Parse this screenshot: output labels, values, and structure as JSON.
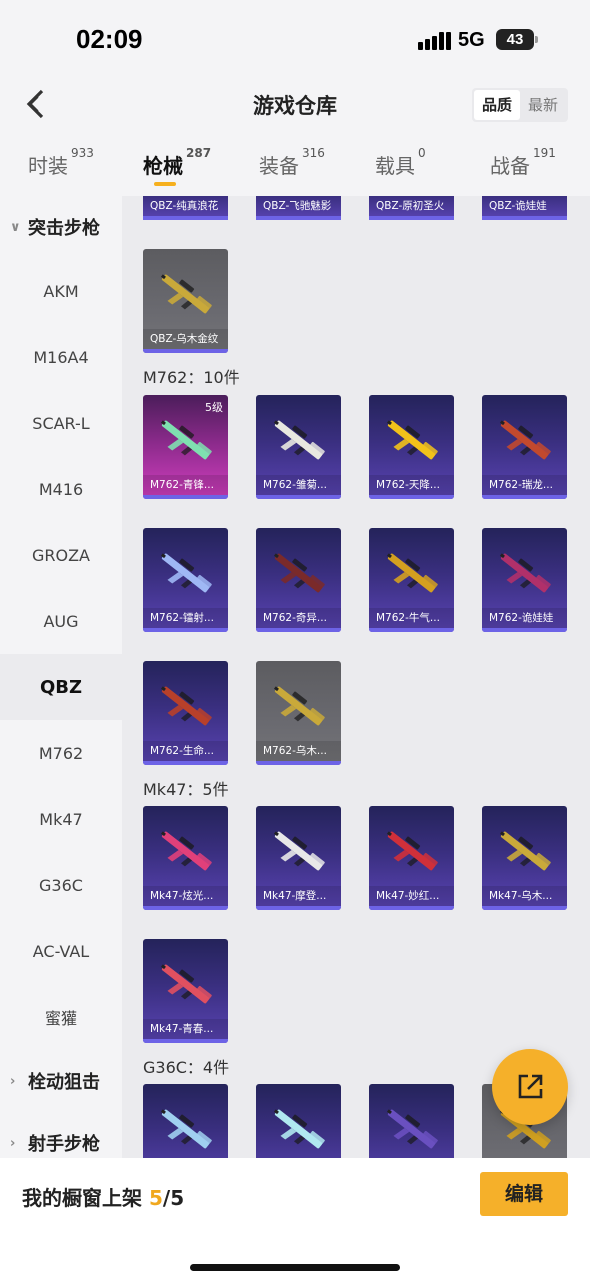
{
  "status_bar": {
    "time": "02:09",
    "network": "5G",
    "battery": "43"
  },
  "header": {
    "title": "游戏仓库",
    "sort_options": [
      "品质",
      "最新"
    ],
    "sort_active": 0
  },
  "tabs": [
    {
      "label": "时装",
      "count": "933"
    },
    {
      "label": "枪械",
      "count": "287"
    },
    {
      "label": "装备",
      "count": "316"
    },
    {
      "label": "载具",
      "count": "0"
    },
    {
      "label": "战备",
      "count": "191"
    }
  ],
  "active_tab": 1,
  "sidebar": {
    "group_assault": "突击步枪",
    "items": [
      "AKM",
      "M16A4",
      "SCAR-L",
      "M416",
      "GROZA",
      "AUG",
      "QBZ",
      "M762",
      "Mk47",
      "G36C",
      "AC-VAL",
      "蜜獾"
    ],
    "active_item": "QBZ",
    "group_bolt": "栓动狙击",
    "group_dmr": "射手步枪"
  },
  "content": {
    "top_partial_labels": [
      "QBZ-纯真浪花",
      "QBZ-飞驰魅影",
      "QBZ-原初圣火",
      "QBZ-诡娃娃"
    ],
    "qbz_last": {
      "label": "QBZ-乌木金纹",
      "style": "gray",
      "gun_color": "#c9a93a"
    },
    "m762_title": "M762：10件",
    "m762": [
      {
        "label": "M762-青锋...",
        "style": "pink",
        "level": "5级",
        "gun_color": "#7fe0b0"
      },
      {
        "label": "M762-雏菊...",
        "style": "purple",
        "gun_color": "#e8e8e0"
      },
      {
        "label": "M762-天降...",
        "style": "purple",
        "gun_color": "#f2c21a"
      },
      {
        "label": "M762-瑞龙...",
        "style": "purple",
        "gun_color": "#c2492e"
      },
      {
        "label": "M762-镭射...",
        "style": "purple",
        "gun_color": "#9fb8f5"
      },
      {
        "label": "M762-奇异...",
        "style": "purple",
        "gun_color": "#7a2a2a"
      },
      {
        "label": "M762-牛气...",
        "style": "purple",
        "gun_color": "#d4a020"
      },
      {
        "label": "M762-诡娃娃",
        "style": "purple",
        "gun_color": "#b0306a"
      },
      {
        "label": "M762-生命...",
        "style": "purple",
        "gun_color": "#b8402a"
      },
      {
        "label": "M762-乌木...",
        "style": "gray",
        "gun_color": "#c9a93a"
      }
    ],
    "mk47_title": "Mk47：5件",
    "mk47": [
      {
        "label": "Mk47-炫光...",
        "style": "purple",
        "gun_color": "#e0407a"
      },
      {
        "label": "Mk47-摩登...",
        "style": "purple",
        "gun_color": "#e8e8e8"
      },
      {
        "label": "Mk47-妙红...",
        "style": "purple",
        "gun_color": "#d0303a"
      },
      {
        "label": "Mk47-乌木...",
        "style": "purple",
        "gun_color": "#c9a93a"
      },
      {
        "label": "Mk47-青春...",
        "style": "purple",
        "gun_color": "#e05060"
      }
    ],
    "g36c_title": "G36C：4件",
    "g36c_gun_colors": [
      "#a0d0f0",
      "#b0e8f0",
      "#6a50c0",
      "#d0a020"
    ]
  },
  "footer": {
    "label": "我的橱窗上架",
    "shown": "5",
    "total": "/5",
    "edit_label": "编辑"
  },
  "colors": {
    "accent": "#f5b02a",
    "card_purple": "#3a2f80",
    "card_pink": "#d23fc0",
    "card_bar": "#6d63e6"
  }
}
